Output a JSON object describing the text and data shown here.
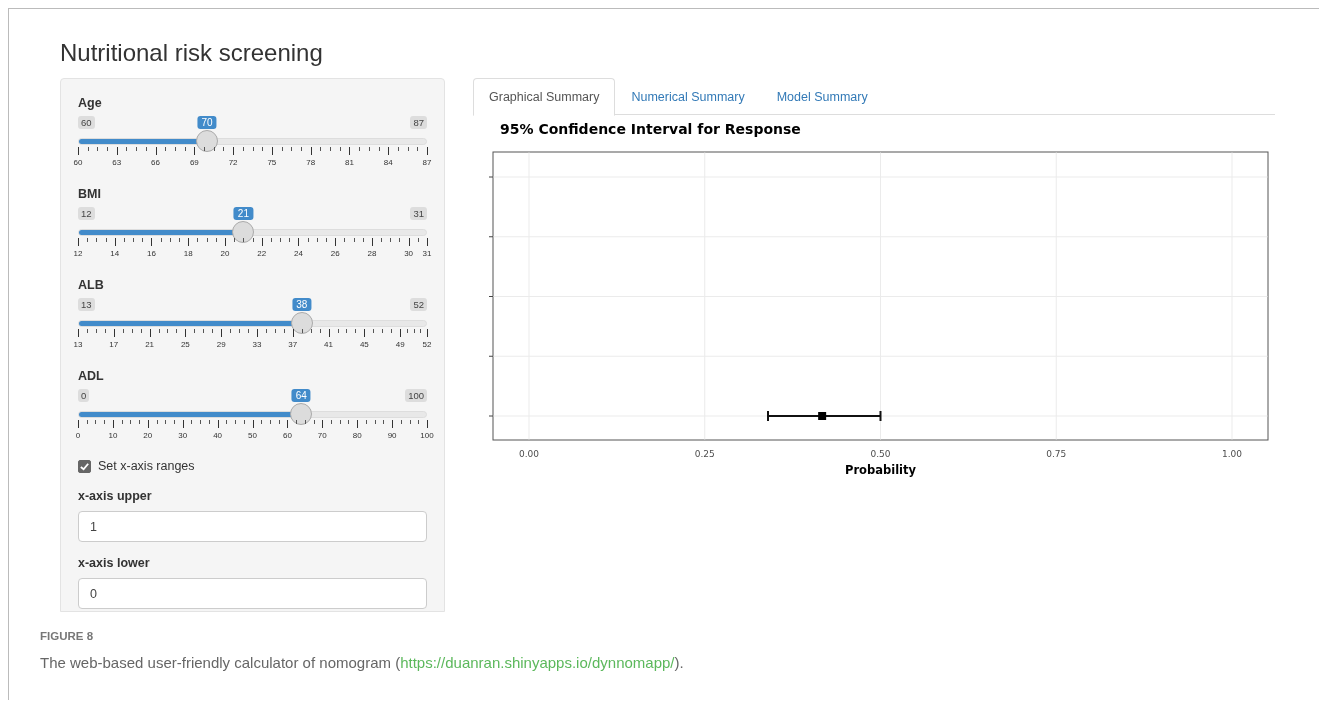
{
  "app": {
    "title": "Nutritional risk screening"
  },
  "sliders": [
    {
      "label": "Age",
      "min": "60",
      "max": "87",
      "value": "70",
      "level": 0.37,
      "ticks": [
        "60",
        "63",
        "66",
        "69",
        "72",
        "75",
        "78",
        "81",
        "84",
        "87"
      ]
    },
    {
      "label": "BMI",
      "min": "12",
      "max": "31",
      "value": "21",
      "level": 0.474,
      "ticks": [
        "12",
        "14",
        "16",
        "18",
        "20",
        "22",
        "24",
        "26",
        "28",
        "30",
        "31"
      ]
    },
    {
      "label": "ALB",
      "min": "13",
      "max": "52",
      "value": "38",
      "level": 0.641,
      "ticks": [
        "13",
        "17",
        "21",
        "25",
        "29",
        "33",
        "37",
        "41",
        "45",
        "49",
        "52"
      ]
    },
    {
      "label": "ADL",
      "min": "0",
      "max": "100",
      "value": "64",
      "level": 0.64,
      "ticks": [
        "0",
        "10",
        "20",
        "30",
        "40",
        "50",
        "60",
        "70",
        "80",
        "90",
        "100"
      ]
    }
  ],
  "checkbox": {
    "label": "Set x-axis ranges",
    "checked": true
  },
  "inputs": [
    {
      "label": "x-axis upper",
      "value": "1"
    },
    {
      "label": "x-axis lower",
      "value": "0"
    }
  ],
  "tabs": [
    {
      "label": "Graphical Summary",
      "selected": true
    },
    {
      "label": "Numerical Summary",
      "selected": false
    },
    {
      "label": "Model Summary",
      "selected": false
    }
  ],
  "chart": {
    "chart_data": {
      "type": "scatter",
      "title": "95% Confidence Interval for Response",
      "xlabel": "Probability",
      "xlim": [
        -0.0512,
        1.0512
      ],
      "xticks": [
        {
          "value": 0,
          "label": "0.00"
        },
        {
          "value": 0.25,
          "label": "0.25"
        },
        {
          "value": 0.5,
          "label": "0.50"
        },
        {
          "value": 0.75,
          "label": "0.75"
        },
        {
          "value": 1,
          "label": "1.00"
        }
      ],
      "orientation": "horizontal",
      "grid": true,
      "categories": [
        null,
        null,
        null,
        null,
        null
      ],
      "series": [
        {
          "values": [
            null,
            null,
            null,
            null,
            0.417
          ],
          "errors": [
            null,
            null,
            null,
            null,
            [
              0.34,
              0.5
            ]
          ]
        }
      ]
    }
  },
  "caption": {
    "label": "FIGURE 8",
    "text": "The web-based user-friendly calculator of nomogram (",
    "link": "https://duanran.shinyapps.io/dynnomapp/",
    "end": ")."
  }
}
